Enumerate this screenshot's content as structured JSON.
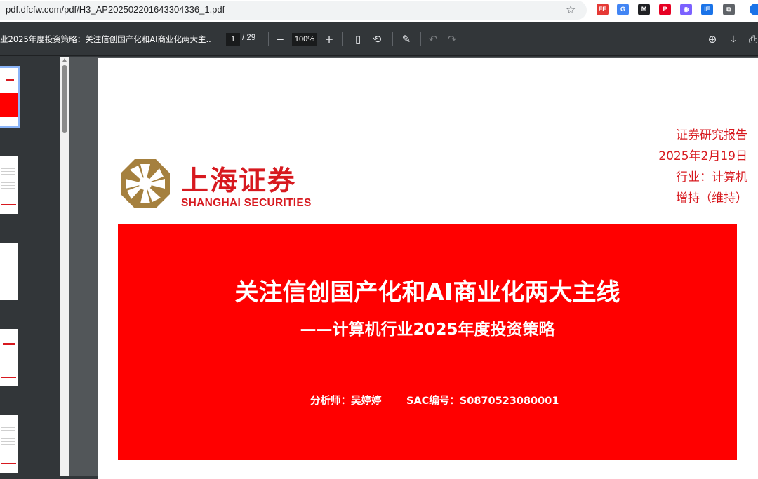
{
  "browser": {
    "url": "pdf.dfcfw.com/pdf/H3_AP202502201643304336_1.pdf",
    "extensions": [
      {
        "name": "fe-extension-icon",
        "label": "FE",
        "color": "#e53935"
      },
      {
        "name": "translate-extension-icon",
        "label": "G",
        "color": "#4285f4"
      },
      {
        "name": "m-extension-icon",
        "label": "M",
        "color": "#202124"
      },
      {
        "name": "pinterest-extension-icon",
        "label": "P",
        "color": "#e60023"
      },
      {
        "name": "eye-extension-icon",
        "label": "◉",
        "color": "#7b61ff"
      },
      {
        "name": "ocr-extension-icon",
        "label": "IE",
        "color": "#1a73e8"
      },
      {
        "name": "puzzle-extension-icon",
        "label": "⧉",
        "color": "#5f6368"
      }
    ]
  },
  "toolbar": {
    "title": "业2025年度投资策略：关注信创国产化和AI商业化两大主...",
    "page_current": "1",
    "page_total": "/ 29",
    "zoom": "100%",
    "zoom_out": "−",
    "zoom_in": "+",
    "fit_icon": "▯",
    "rotate_icon": "⟲",
    "draw_icon": "✎",
    "undo_icon": "↶",
    "redo_icon": "↷",
    "save_icon": "⊕",
    "download_icon": "⤓",
    "print_icon": "⎙"
  },
  "document": {
    "logo_cn": "上海证券",
    "logo_en": "SHANGHAI SECURITIES",
    "meta": [
      "证券研究报告",
      "2025年2月19日",
      "行业：计算机",
      "增持（维持）"
    ],
    "title": "关注信创国产化和AI商业化两大主线",
    "subtitle": "——计算机行业2025年度投资策略",
    "analyst": "分析师：吴婷婷",
    "sac": "SAC编号：S0870523080001"
  },
  "colors": {
    "brand_red": "#d7191f",
    "banner_red": "#ff0000",
    "logo_gold": "#a5803e"
  }
}
